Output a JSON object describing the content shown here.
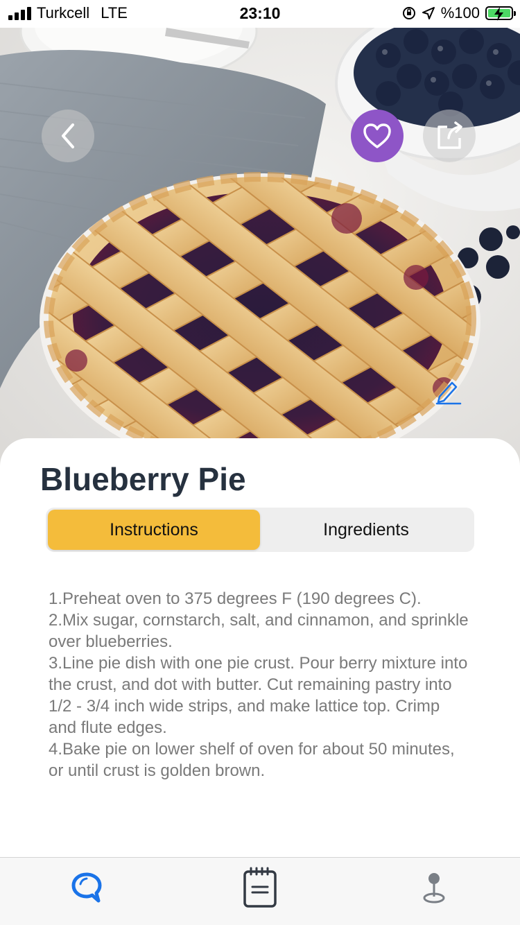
{
  "status_bar": {
    "carrier": "Turkcell",
    "network": "LTE",
    "time": "23:10",
    "battery": "%100",
    "battery_level_percent": 100,
    "signal_bars": 4
  },
  "colors": {
    "favorite": "#8e55c7",
    "active_tab": "#f4bc3b",
    "title": "#26313f",
    "tab_active_icon": "#1a73e8",
    "battery": "#4cd964"
  },
  "hero": {
    "icons": [
      "back-icon",
      "heart-icon",
      "share-icon",
      "edit-icon"
    ]
  },
  "recipe": {
    "title": "Blueberry Pie",
    "tabs": [
      {
        "label": "Instructions",
        "active": true
      },
      {
        "label": "Ingredients",
        "active": false
      }
    ],
    "instructions": [
      "1.Preheat oven to 375 degrees F (190 degrees C).",
      "2.Mix sugar, cornstarch, salt, and cinnamon, and sprinkle over blueberries.",
      "3.Line pie dish with one pie crust. Pour berry mixture into the crust, and dot with butter. Cut remaining pastry into 1/2 - 3/4 inch wide strips, and make lattice top. Crimp and flute edges.",
      "4.Bake pie on lower shelf of oven for about 50 minutes, or until crust is golden brown."
    ]
  },
  "tab_bar": {
    "items": [
      {
        "icon": "search-chat-icon",
        "active": true
      },
      {
        "icon": "notepad-icon",
        "active": false
      },
      {
        "icon": "location-pin-icon",
        "active": false
      }
    ]
  }
}
